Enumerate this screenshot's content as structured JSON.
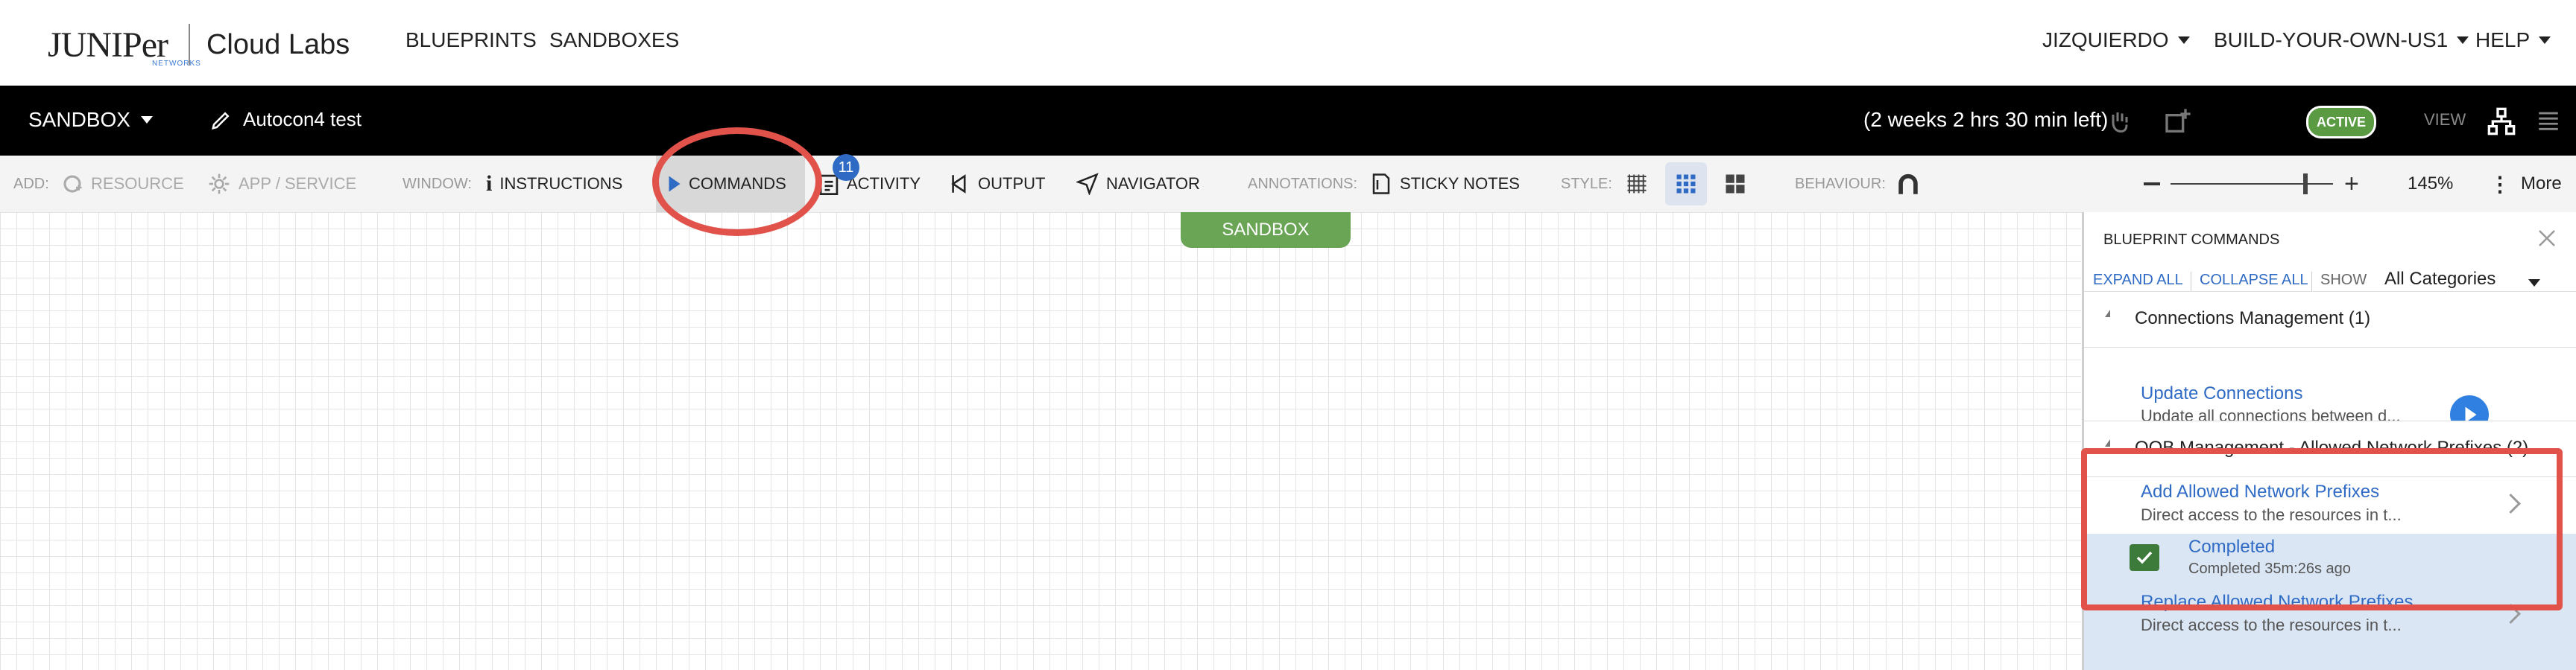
{
  "brand": {
    "logo_text": "JUNIPer",
    "logo_sub": "NETWORKS",
    "product": "Cloud Labs"
  },
  "nav": {
    "blueprints": "BLUEPRINTS",
    "sandboxes": "SANDBOXES"
  },
  "user_menu": {
    "user": "JIZQUIERDO",
    "domain": "BUILD-YOUR-OWN-US1",
    "help": "HELP"
  },
  "sandbox_bar": {
    "label": "SANDBOX",
    "name": "Autocon4 test",
    "time_remaining": "(2 weeks 2 hrs 30 min left)",
    "status": "ACTIVE",
    "view_label": "VIEW"
  },
  "toolbar": {
    "add_label": "ADD:",
    "resource": "RESOURCE",
    "app_service": "APP / SERVICE",
    "window_label": "WINDOW:",
    "instructions": "INSTRUCTIONS",
    "commands": "COMMANDS",
    "activity": "ACTIVITY",
    "activity_badge": "11",
    "output": "OUTPUT",
    "navigator": "NAVIGATOR",
    "annotations_label": "ANNOTATIONS:",
    "sticky_notes": "STICKY NOTES",
    "style_label": "STYLE:",
    "behaviour_label": "BEHAVIOUR:",
    "zoom": "145%",
    "more": "More"
  },
  "canvas": {
    "sandbox_tab": "SANDBOX"
  },
  "panel": {
    "title": "BLUEPRINT COMMANDS",
    "expand_all": "EXPAND ALL",
    "collapse_all": "COLLAPSE ALL",
    "show_label": "SHOW",
    "category": "All Categories",
    "groups": [
      {
        "title": "Connections Management (1)",
        "commands": [
          {
            "name": "Update Connections",
            "desc": "Update all connections between d..."
          }
        ]
      },
      {
        "title": "OOB Management - Allowed Network Prefixes (2)",
        "commands": [
          {
            "name": "Add Allowed Network Prefixes",
            "desc": "Direct access to the resources in t...",
            "status": "Completed",
            "status_detail": "Completed 35m:26s ago"
          },
          {
            "name": "Replace Allowed Network Prefixes",
            "desc": "Direct access to the resources in t..."
          }
        ]
      }
    ]
  },
  "colors": {
    "accent": "#2f6bc4",
    "active_green": "#5a9a43",
    "highlight_red": "#e0524a"
  }
}
